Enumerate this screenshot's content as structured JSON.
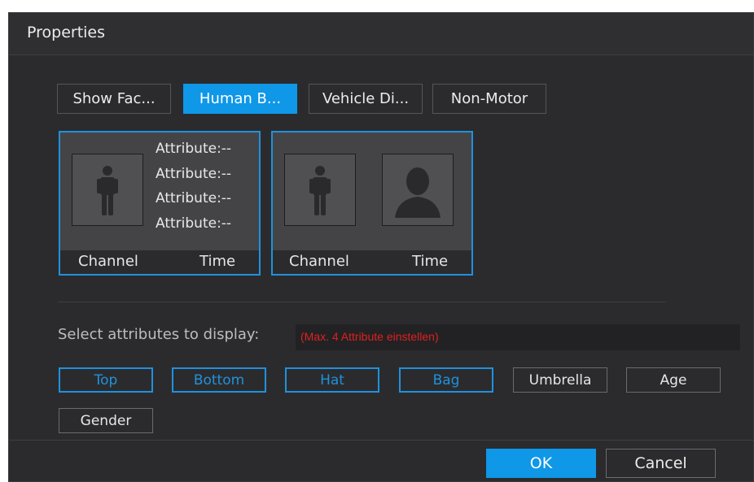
{
  "dialog": {
    "title": "Properties"
  },
  "tabs": [
    {
      "label": "Show Fac..."
    },
    {
      "label": "Human B...",
      "active": true
    },
    {
      "label": "Vehicle Di..."
    },
    {
      "label": "Non-Motor"
    }
  ],
  "card1": {
    "attributes": [
      "Attribute:--",
      "Attribute:--",
      "Attribute:--",
      "Attribute:--"
    ],
    "channel_label": "Channel",
    "time_label": "Time"
  },
  "card2": {
    "channel_label": "Channel",
    "time_label": "Time"
  },
  "select": {
    "label": "Select attributes to display:",
    "hint": "(Max. 4 Attribute einstellen)"
  },
  "attribute_options": [
    {
      "label": "Top",
      "selected": true
    },
    {
      "label": "Bottom",
      "selected": true
    },
    {
      "label": "Hat",
      "selected": true
    },
    {
      "label": "Bag",
      "selected": true
    },
    {
      "label": "Umbrella",
      "selected": false
    },
    {
      "label": "Age",
      "selected": false
    },
    {
      "label": "Gender",
      "selected": false
    }
  ],
  "buttons": {
    "ok": "OK",
    "cancel": "Cancel"
  },
  "colors": {
    "accent": "#0f97e8",
    "hint": "#e02020",
    "background": "#2b2b2e"
  }
}
